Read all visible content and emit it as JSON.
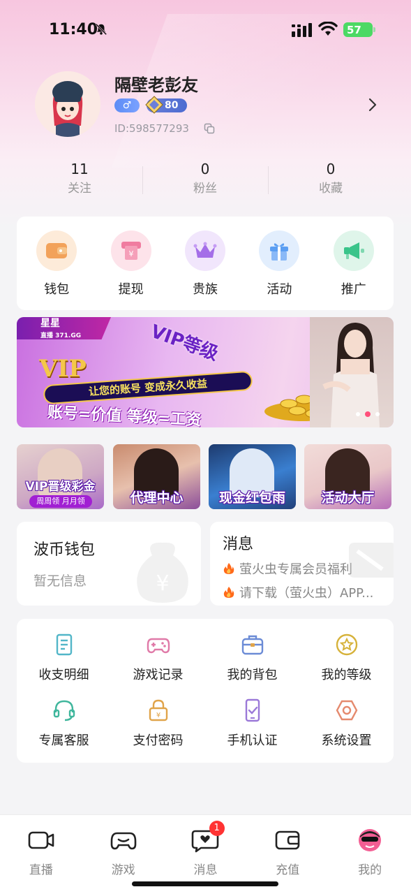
{
  "status_bar": {
    "time": "11:40",
    "battery": "57"
  },
  "profile": {
    "username": "隔壁老彭友",
    "gender_symbol": "♂",
    "level": "80",
    "user_id": "ID:598577293"
  },
  "stats": [
    {
      "value": "11",
      "label": "关注"
    },
    {
      "value": "0",
      "label": "粉丝"
    },
    {
      "value": "0",
      "label": "收藏"
    }
  ],
  "quick_menu": [
    {
      "label": "钱包",
      "icon": "wallet-icon",
      "color": "#f2a25a"
    },
    {
      "label": "提现",
      "icon": "withdraw-icon",
      "color": "#f07ca0"
    },
    {
      "label": "贵族",
      "icon": "crown-icon",
      "color": "#a46ee8"
    },
    {
      "label": "活动",
      "icon": "gift-icon",
      "color": "#5b9ef2"
    },
    {
      "label": "推广",
      "icon": "megaphone-icon",
      "color": "#3ac48a"
    }
  ],
  "banner": {
    "tag_title": "星星",
    "tag_sub": "直播 371.GG",
    "vip_logo": "VIP",
    "heading": "VIP等级",
    "ribbon": "让您的账号 变成永久收益",
    "slogan": "账号=价值 等级=工资"
  },
  "promos": [
    {
      "label": "VIP晋级彩金",
      "sub": "周周领 月月领"
    },
    {
      "label": "代理中心"
    },
    {
      "label": "现金红包雨"
    },
    {
      "label": "活动大厅"
    }
  ],
  "wallet_card": {
    "title": "波币钱包",
    "subtitle": "暂无信息"
  },
  "message_card": {
    "title": "消息",
    "lines": [
      "萤火虫专属会员福利",
      "请下载（萤火虫）APP..."
    ]
  },
  "grid_menu": [
    {
      "label": "收支明细",
      "icon": "ledger-icon"
    },
    {
      "label": "游戏记录",
      "icon": "gamepad-icon"
    },
    {
      "label": "我的背包",
      "icon": "backpack-icon"
    },
    {
      "label": "我的等级",
      "icon": "level-star-icon"
    },
    {
      "label": "专属客服",
      "icon": "headset-icon"
    },
    {
      "label": "支付密码",
      "icon": "lock-icon"
    },
    {
      "label": "手机认证",
      "icon": "phone-check-icon"
    },
    {
      "label": "系统设置",
      "icon": "settings-icon"
    }
  ],
  "tabs": [
    {
      "label": "直播",
      "icon": "camera-icon"
    },
    {
      "label": "游戏",
      "icon": "gamepad-icon"
    },
    {
      "label": "消息",
      "icon": "chat-icon",
      "badge": "1"
    },
    {
      "label": "充值",
      "icon": "wallet-icon"
    },
    {
      "label": "我的",
      "icon": "profile-avatar-icon",
      "active": true
    }
  ]
}
